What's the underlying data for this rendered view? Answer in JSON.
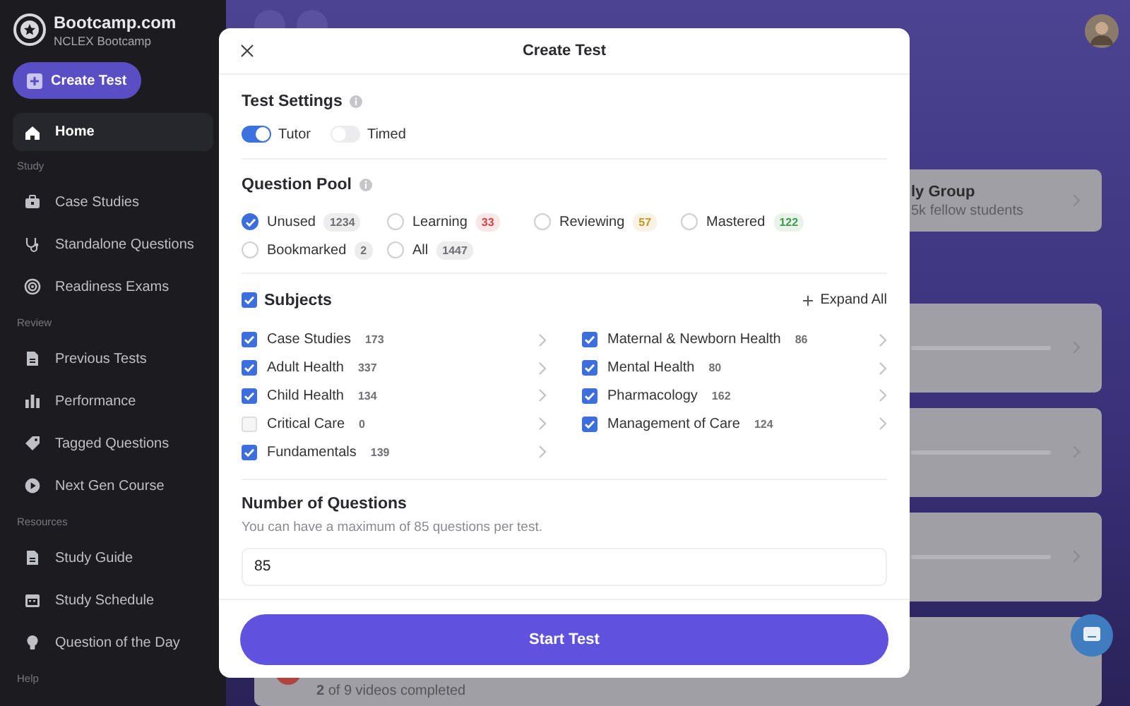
{
  "sidebar": {
    "brand": "Bootcamp.com",
    "subtitle": "NCLEX Bootcamp",
    "create_button": "Create Test",
    "sections": [
      {
        "items": [
          {
            "label": "Home",
            "selected": true
          }
        ]
      },
      {
        "heading": "Study",
        "items": [
          {
            "label": "Case Studies",
            "selected": false
          },
          {
            "label": "Standalone Questions",
            "selected": false
          },
          {
            "label": "Readiness Exams",
            "selected": false
          }
        ]
      },
      {
        "heading": "Review",
        "items": [
          {
            "label": "Previous Tests",
            "selected": false
          },
          {
            "label": "Performance",
            "selected": false
          },
          {
            "label": "Tagged Questions",
            "selected": false
          },
          {
            "label": "Next Gen Course",
            "selected": false
          }
        ]
      },
      {
        "heading": "Resources",
        "items": [
          {
            "label": "Study Guide",
            "selected": false
          },
          {
            "label": "Study Schedule",
            "selected": false
          },
          {
            "label": "Question of the Day",
            "selected": false
          }
        ]
      },
      {
        "heading": "Help"
      }
    ]
  },
  "background": {
    "group_card": {
      "title": "ly Group",
      "subtitle": "5k fellow students"
    },
    "course_card": {
      "progress": "**2** of 9 videos completed"
    }
  },
  "modal": {
    "title": "Create Test",
    "settings": {
      "heading": "Test Settings",
      "toggles": [
        {
          "label": "Tutor",
          "on": true
        },
        {
          "label": "Timed",
          "on": false
        }
      ]
    },
    "pool": {
      "heading": "Question Pool",
      "options": [
        {
          "label": "Unused",
          "count": "1234",
          "selected": true,
          "color": "#6e6e74"
        },
        {
          "label": "Learning",
          "count": "33",
          "selected": false,
          "color": "#d64545"
        },
        {
          "label": "Reviewing",
          "count": "57",
          "selected": false,
          "color": "#c39a1e"
        },
        {
          "label": "Mastered",
          "count": "122",
          "selected": false,
          "color": "#3f9a4e"
        },
        {
          "label": "Bookmarked",
          "count": "2",
          "selected": false,
          "color": "#6e6e74"
        },
        {
          "label": "All",
          "count": "1447",
          "selected": false,
          "color": "#6e6e74"
        }
      ]
    },
    "subjects": {
      "label": "Subjects",
      "checked": true,
      "expand": "Expand All",
      "items": [
        {
          "label": "Case Studies",
          "count": "173",
          "checked": true
        },
        {
          "label": "Adult Health",
          "count": "337",
          "checked": true
        },
        {
          "label": "Child Health",
          "count": "134",
          "checked": true
        },
        {
          "label": "Critical Care",
          "count": "0",
          "checked": false
        },
        {
          "label": "Fundamentals",
          "count": "139",
          "checked": true
        },
        {
          "label": "Maternal & Newborn Health",
          "count": "86",
          "checked": true
        },
        {
          "label": "Mental Health",
          "count": "80",
          "checked": true
        },
        {
          "label": "Pharmacology",
          "count": "162",
          "checked": true
        },
        {
          "label": "Management of Care",
          "count": "124",
          "checked": true
        }
      ]
    },
    "number": {
      "heading": "Number of Questions",
      "hint": "You can have a maximum of 85 questions per test.",
      "value": "85"
    },
    "start_button": "Start Test"
  }
}
